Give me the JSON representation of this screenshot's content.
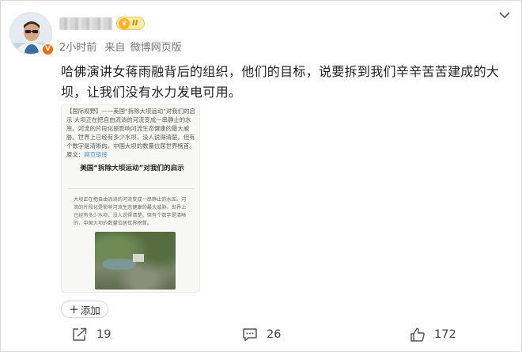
{
  "post": {
    "author_level": "II",
    "time": "2小时前",
    "source_prefix": "来自",
    "source": "微博网页版",
    "text": "哈佛演讲女蒋雨融背后的组织，他们的目标，说要拆到我们辛辛苦苦建成的大坝，让我们没有水力发电可用。",
    "avatar_badge": "V"
  },
  "image": {
    "top_text_lead": "【国际视野】——美国“拆除大坝运动”对我们的启示 大坝正在把自由流淌的河流变成一串静止的水库。河流的片段化是影响河流生态健康的最大威胁。世界上已经有多少水坝，没人说得清楚。但有个数字是清晰的，中国大坝的数量位居世界榜首。原文：",
    "top_text_link": "网页链接",
    "heading": "美国“拆除大坝运动”对我们的启示",
    "body_text": "大坝正在把自由流淌的河流变成一串静止的水库。河流的片段化是影响河流生态健康的最大威胁。世界上已经有多少水坝，没人说得清楚。但有个数字是清晰的，中国大坝的数量位居世界榜首。"
  },
  "add_button": {
    "label": "添加",
    "plus": "+"
  },
  "actions": {
    "forward_count": "19",
    "comment_count": "26",
    "like_count": "172"
  },
  "icons": {
    "more": "chevron-down-icon",
    "forward": "forward-icon",
    "comment": "comment-icon",
    "like": "thumbs-up-icon"
  },
  "colors": {
    "badge_orange": "#f26a0c",
    "link_blue": "#4a8fd3",
    "text_dark": "#222222",
    "meta_gray": "#777777"
  }
}
